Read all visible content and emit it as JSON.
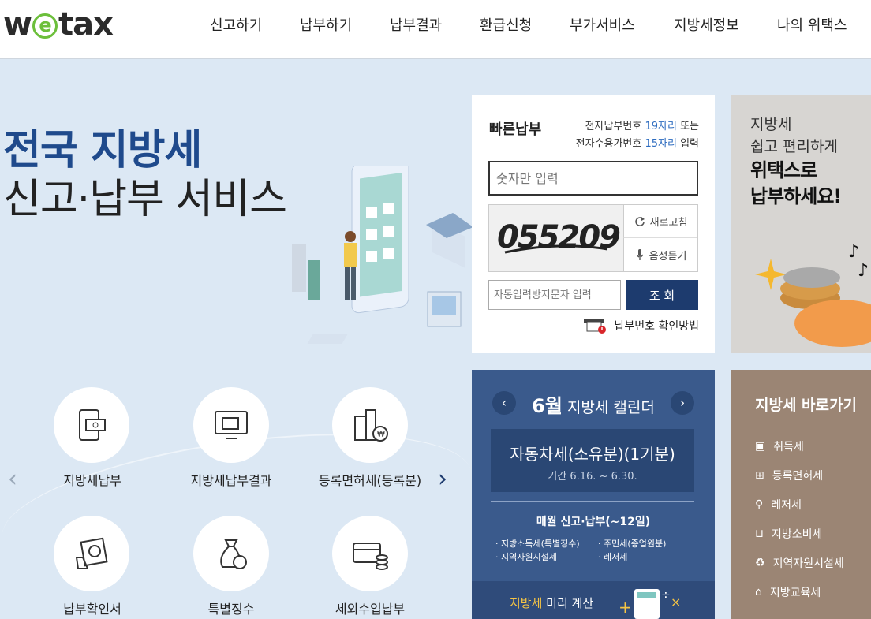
{
  "logo": {
    "pre": "w",
    "e": "e",
    "post": "tax"
  },
  "nav": [
    "신고하기",
    "납부하기",
    "납부결과",
    "환급신청",
    "부가서비스",
    "지방세정보",
    "나의 위택스"
  ],
  "hero": {
    "line1": "전국 지방세",
    "line2": "신고·납부 서비스"
  },
  "quick_pay": {
    "title": "빠른납부",
    "desc1_pre": "전자납부번호 ",
    "desc1_hl": "19자리",
    "desc1_post": " 또는",
    "desc2_pre": "전자수용가번호 ",
    "desc2_hl": "15자리",
    "desc2_post": " 입력",
    "number_placeholder": "숫자만 입력",
    "captcha_text": "055209",
    "refresh_label": "새로고침",
    "audio_label": "음성듣기",
    "captcha_placeholder": "자동입력방지문자 입력",
    "search_label": "조 회",
    "how_label": "납부번호 확인방법"
  },
  "promo": {
    "line1": "지방세",
    "line2": "쉽고 편리하게",
    "line3": "위택스로",
    "line4": "납부하세요!"
  },
  "calendar": {
    "month": "6월",
    "title": " 지방세 캘린더",
    "item_title": "자동차세(소유분)(1기분)",
    "item_period": "기간 6.16. ~ 6.30.",
    "monthly_title": "매월 신고·납부(~12일)",
    "monthly_items": [
      "· 지방소득세(특별징수)",
      "· 주민세(종업원분)",
      "· 지역자원시설세",
      "· 레저세"
    ],
    "calc_hl": "지방세",
    "calc_post": " 미리 계산"
  },
  "shortcut": {
    "title": "지방세 바로가기",
    "items": [
      "취득세",
      "등록면허세",
      "레저세",
      "지방소비세",
      "지역자원시설세",
      "지방교육세"
    ]
  },
  "services": [
    "지방세납부",
    "지방세납부결과",
    "등록면허세(등록분)",
    "납부확인서",
    "특별징수",
    "세외수입납부"
  ],
  "colors": {
    "accent": "#1f4a8c",
    "dark_button": "#1d3b6e",
    "calendar_bg": "#3a5a8c",
    "shortcut_bg": "#9b8574"
  }
}
